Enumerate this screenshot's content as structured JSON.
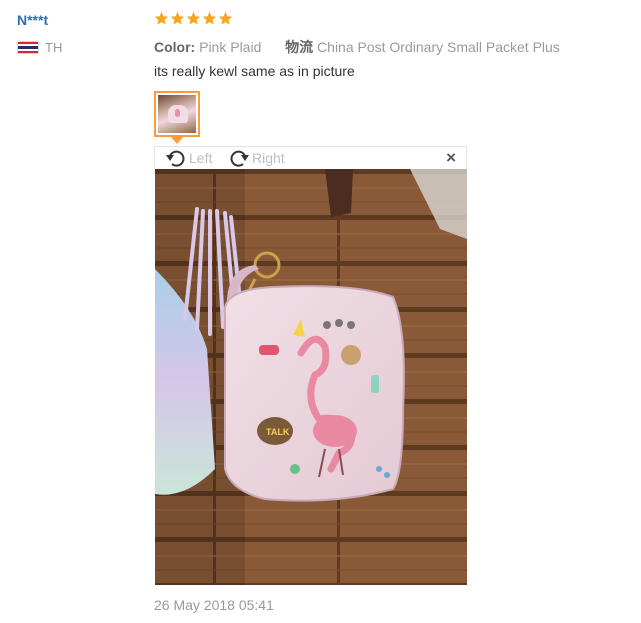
{
  "review": {
    "user_name": "N***t",
    "country_code": "TH",
    "rating": 5,
    "rating_max": 5,
    "color_label": "Color:",
    "color_value": "Pink Plaid",
    "logistics_label": "物流",
    "logistics_value": "China Post Ordinary Small Packet Plus",
    "text": "its really kewl same as in picture",
    "date": "26 May 2018 05:41"
  },
  "viewer": {
    "rotate_left_label": "Left",
    "rotate_right_label": "Right",
    "close_glyph": "×"
  },
  "photo": {
    "written_text": "TALK"
  },
  "icons": {
    "star": "star-icon",
    "rotate_left": "rotate-left-icon",
    "rotate_right": "rotate-right-icon",
    "close": "close-icon",
    "flag": "flag-thailand-icon"
  },
  "colors": {
    "user_link": "#2f6fb3",
    "star": "#f5a623",
    "thumb_border": "#ff9a3c",
    "meta_text": "#9a9a9a",
    "flag_red": "#d4253a",
    "flag_white": "#ffffff",
    "flag_blue": "#2d2a6e"
  }
}
